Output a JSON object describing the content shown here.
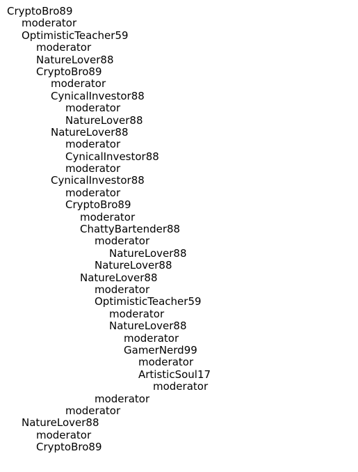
{
  "tree": {
    "nodes": [
      {
        "label": "CryptoBro89",
        "depth": 0
      },
      {
        "label": "moderator",
        "depth": 1
      },
      {
        "label": "OptimisticTeacher59",
        "depth": 1
      },
      {
        "label": "moderator",
        "depth": 2
      },
      {
        "label": "NatureLover88",
        "depth": 2
      },
      {
        "label": "CryptoBro89",
        "depth": 2
      },
      {
        "label": "moderator",
        "depth": 3
      },
      {
        "label": "CynicalInvestor88",
        "depth": 3
      },
      {
        "label": "moderator",
        "depth": 4
      },
      {
        "label": "NatureLover88",
        "depth": 4
      },
      {
        "label": "NatureLover88",
        "depth": 3
      },
      {
        "label": "moderator",
        "depth": 4
      },
      {
        "label": "CynicalInvestor88",
        "depth": 4
      },
      {
        "label": "moderator",
        "depth": 4
      },
      {
        "label": "CynicalInvestor88",
        "depth": 3
      },
      {
        "label": "moderator",
        "depth": 4
      },
      {
        "label": "CryptoBro89",
        "depth": 4
      },
      {
        "label": "moderator",
        "depth": 5
      },
      {
        "label": "ChattyBartender88",
        "depth": 5
      },
      {
        "label": "moderator",
        "depth": 6
      },
      {
        "label": "NatureLover88",
        "depth": 7
      },
      {
        "label": "NatureLover88",
        "depth": 6
      },
      {
        "label": "NatureLover88",
        "depth": 5
      },
      {
        "label": "moderator",
        "depth": 6
      },
      {
        "label": "OptimisticTeacher59",
        "depth": 6
      },
      {
        "label": "moderator",
        "depth": 7
      },
      {
        "label": "NatureLover88",
        "depth": 7
      },
      {
        "label": "moderator",
        "depth": 8
      },
      {
        "label": "GamerNerd99",
        "depth": 8
      },
      {
        "label": "moderator",
        "depth": 9
      },
      {
        "label": "ArtisticSoul17",
        "depth": 9
      },
      {
        "label": "moderator",
        "depth": 10
      },
      {
        "label": "moderator",
        "depth": 6
      },
      {
        "label": "moderator",
        "depth": 4
      },
      {
        "label": "NatureLover88",
        "depth": 1
      },
      {
        "label": "moderator",
        "depth": 2
      },
      {
        "label": "CryptoBro89",
        "depth": 2
      }
    ]
  }
}
